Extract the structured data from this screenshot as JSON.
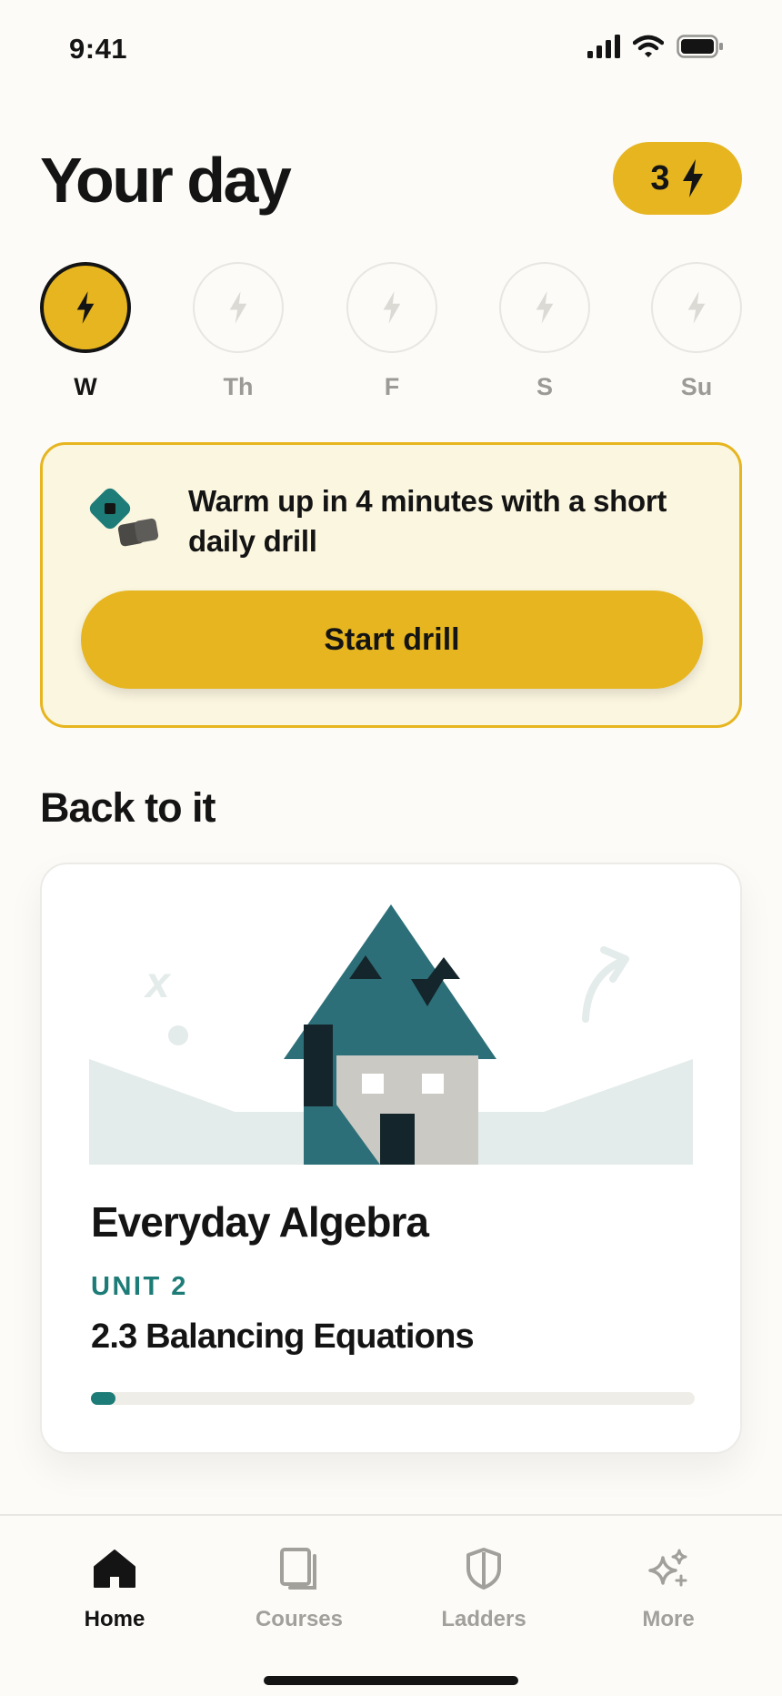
{
  "status_bar": {
    "time": "9:41"
  },
  "header": {
    "title": "Your day",
    "streak_count": "3"
  },
  "week": {
    "days": [
      {
        "label": "W",
        "active": true
      },
      {
        "label": "Th",
        "active": false
      },
      {
        "label": "F",
        "active": false
      },
      {
        "label": "S",
        "active": false
      },
      {
        "label": "Su",
        "active": false
      }
    ]
  },
  "drill": {
    "text": "Warm up in 4 minutes with a short daily drill",
    "button_label": "Start drill"
  },
  "back_to_it": {
    "section_title": "Back to it",
    "course": {
      "title": "Everyday Algebra",
      "unit": "UNIT 2",
      "lesson": "2.3 Balancing Equations",
      "progress_fraction": 0.04,
      "art_letter": "x"
    }
  },
  "tab_bar": {
    "tabs": [
      {
        "label": "Home",
        "icon": "home-icon",
        "active": true
      },
      {
        "label": "Courses",
        "icon": "courses-icon",
        "active": false
      },
      {
        "label": "Ladders",
        "icon": "shield-icon",
        "active": false
      },
      {
        "label": "More",
        "icon": "sparkles-icon",
        "active": false
      }
    ]
  },
  "colors": {
    "accent_yellow": "#e6b51f",
    "accent_teal": "#1d7c77",
    "ink": "#141414",
    "muted": "#a2a09b"
  }
}
